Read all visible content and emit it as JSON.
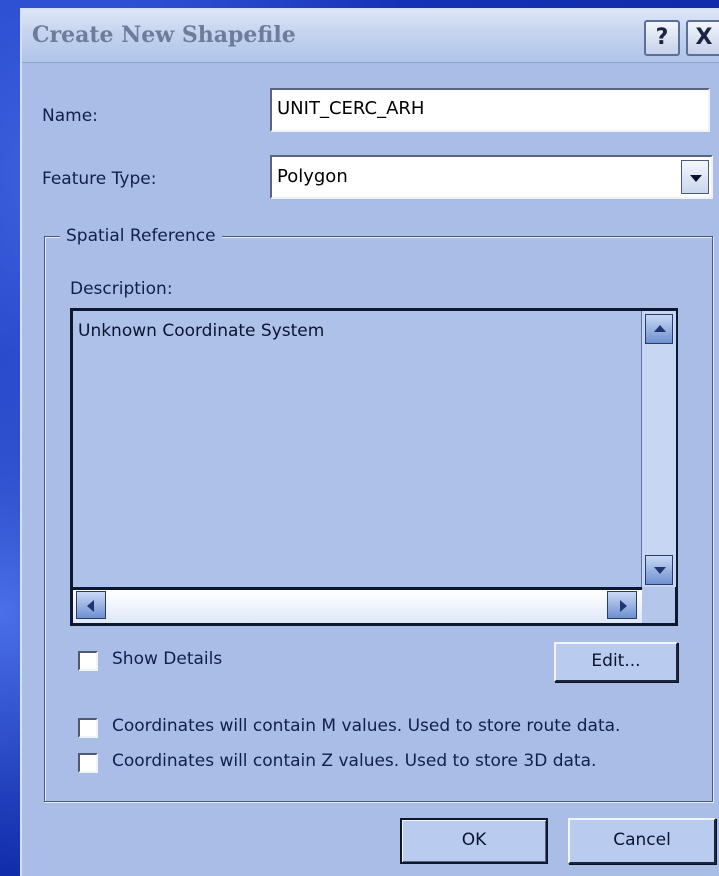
{
  "window": {
    "title": "Create New Shapefile",
    "help_label": "?",
    "close_label": "X"
  },
  "form": {
    "name_label": "Name:",
    "name_value": "UNIT_CERC_ARH",
    "feature_type_label": "Feature Type:",
    "feature_type_value": "Polygon"
  },
  "spatial_reference": {
    "group_label": "Spatial Reference",
    "description_label": "Description:",
    "description_text": "Unknown Coordinate System",
    "show_details_label": "Show Details",
    "show_details_checked": false,
    "edit_label": "Edit..."
  },
  "options": {
    "m_values_label": "Coordinates will contain M values. Used to store route data.",
    "m_values_checked": false,
    "z_values_label": "Coordinates will contain Z values. Used to store 3D data.",
    "z_values_checked": false
  },
  "footer": {
    "ok_label": "OK",
    "cancel_label": "Cancel"
  },
  "colors": {
    "dialog_bg": "#a9bde6",
    "desktop_bg": "#1533b8",
    "title_text": "#6d7c9a"
  }
}
